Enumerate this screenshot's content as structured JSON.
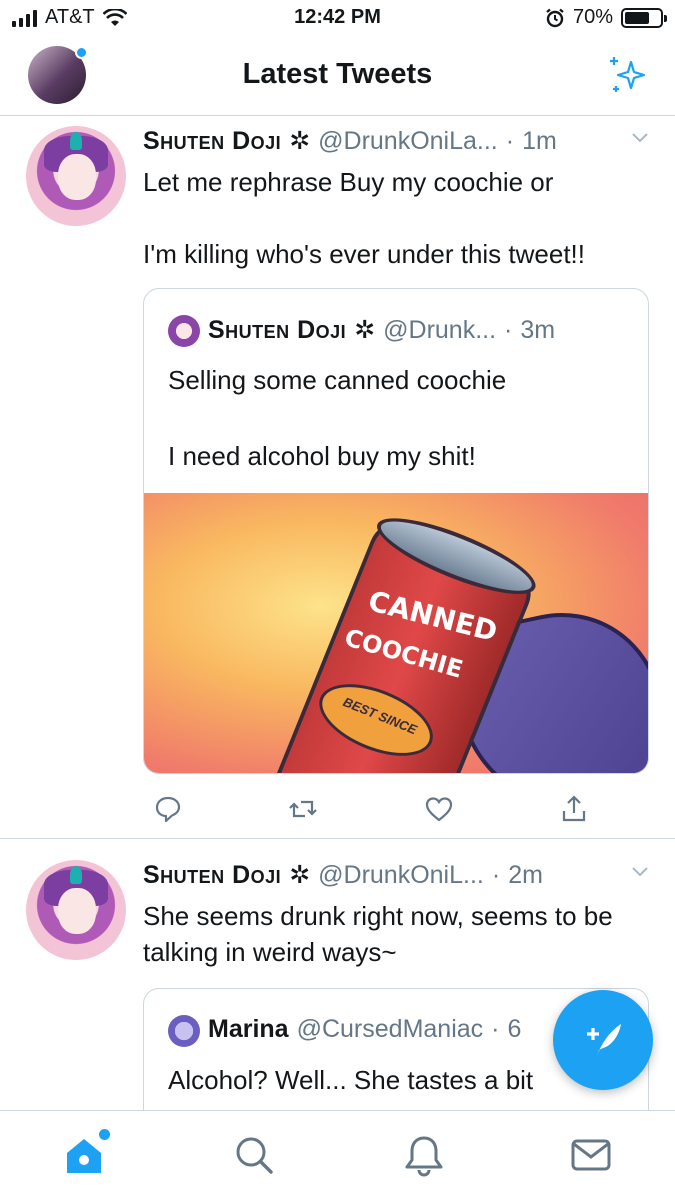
{
  "status_bar": {
    "carrier": "AT&T",
    "time": "12:42 PM",
    "battery": "70%",
    "battery_level": 0.7
  },
  "header": {
    "title": "Latest Tweets",
    "left_icon": "profile-avatar",
    "right_icon": "sparkle-icon"
  },
  "tweets": [
    {
      "name": "Shuten Doji",
      "badge": "✲",
      "handle": "@DrunkOniLa...",
      "separator": "·",
      "time": "1m",
      "text": "Let me rephrase Buy my coochie or\n\nI'm killing who's ever under this tweet!!",
      "quote": {
        "name": "Shuten Doji",
        "badge": "✲",
        "handle": "@Drunk...",
        "separator": "·",
        "time": "3m",
        "text": "Selling some canned coochie\n\nI need alcohol buy my shit!",
        "media": {
          "label_line1": "CANNED",
          "label_line2": "COOCHIE",
          "badge_text": "BEST SINCE"
        }
      }
    },
    {
      "name": "Shuten Doji",
      "badge": "✲",
      "handle": "@DrunkOniL...",
      "separator": "·",
      "time": "2m",
      "text": "She seems drunk right now, seems to be talking in weird ways~",
      "quote": {
        "name": "Marina",
        "handle": "@CursedManiac",
        "separator": "·",
        "time": "6",
        "text": "Alcohol? Well... She tastes a bit"
      }
    }
  ],
  "tabs": [
    {
      "name": "home",
      "icon": "home-icon"
    },
    {
      "name": "search",
      "icon": "search-icon"
    },
    {
      "name": "notifications",
      "icon": "bell-icon"
    },
    {
      "name": "messages",
      "icon": "mail-icon"
    }
  ],
  "colors": {
    "accent": "#1da1f2",
    "text": "#14171a",
    "secondary": "#657786",
    "border": "#ccd6dd"
  }
}
